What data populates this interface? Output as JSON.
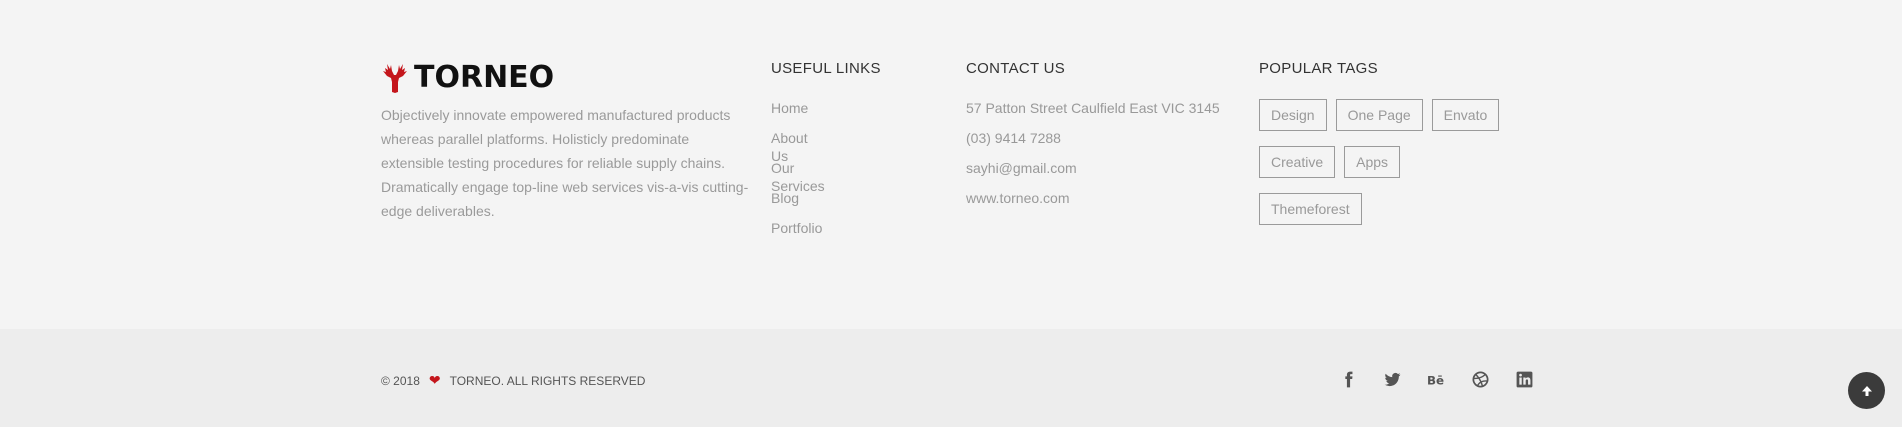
{
  "brand": {
    "name": "TORNEO",
    "accent": "#c4161c"
  },
  "about": {
    "text": "Objectively innovate empowered manufactured products whereas parallel platforms. Holisticly predominate extensible testing procedures for reliable supply chains. Dramatically engage top-line web services vis-a-vis cutting-edge deliverables."
  },
  "useful_links": {
    "title": "USEFUL LINKS",
    "items": [
      "Home",
      "About Us",
      "Our Services",
      "Blog",
      "Portfolio"
    ]
  },
  "contact": {
    "title": "CONTACT US",
    "items": [
      "57 Patton Street Caulfield East VIC 3145",
      "(03) 9414 7288",
      "sayhi@gmail.com",
      "www.torneo.com"
    ]
  },
  "popular_tags": {
    "title": "POPULAR TAGS",
    "items": [
      "Design",
      "One Page",
      "Envato",
      "Creative",
      "Apps",
      "Themeforest"
    ]
  },
  "copyright": {
    "year": "© 2018",
    "text": "TORNEO. ALL RIGHTS RESERVED"
  },
  "socials": [
    "facebook-icon",
    "twitter-icon",
    "behance-icon",
    "dribbble-icon",
    "linkedin-icon"
  ]
}
